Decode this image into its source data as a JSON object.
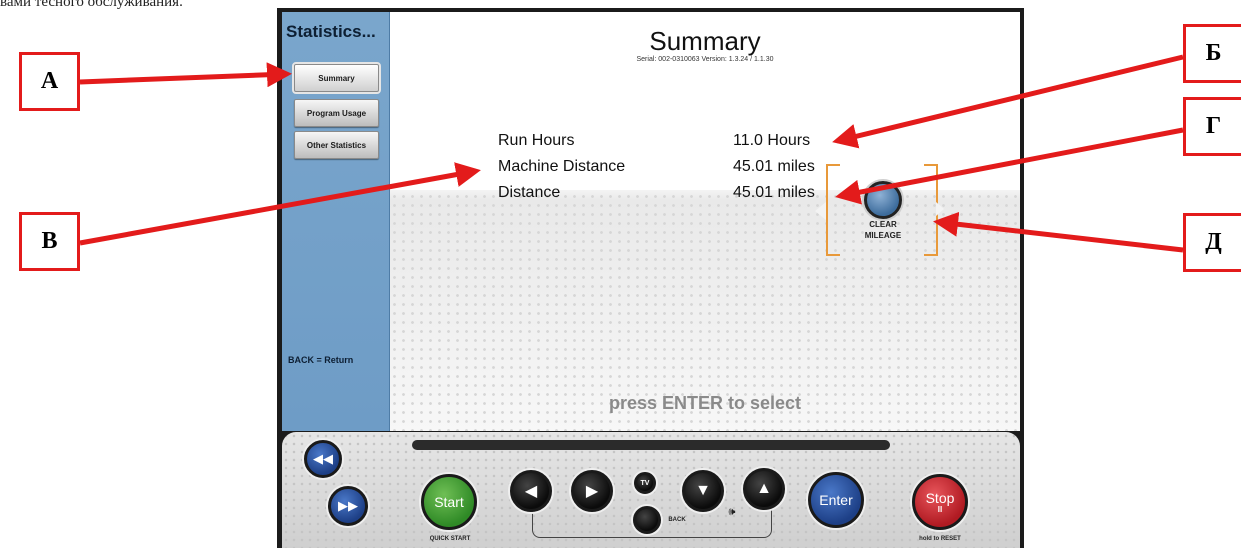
{
  "caption": "вами тесного обслуживания.",
  "sidebar": {
    "title": "Statistics...",
    "items": [
      {
        "label": "Summary"
      },
      {
        "label": "Program Usage"
      },
      {
        "label": "Other Statistics"
      }
    ],
    "back_hint": "BACK = Return"
  },
  "main": {
    "title": "Summary",
    "serial": "Serial: 002-0310063  Version: 1.3.24 / 1.1.30",
    "stats": [
      {
        "label": "Run Hours",
        "value": "11.0 Hours"
      },
      {
        "label": "Machine Distance",
        "value": "45.01 miles"
      },
      {
        "label": "Distance",
        "value": "45.01 miles"
      }
    ],
    "clear_button": {
      "line1": "CLEAR",
      "line2": "MILEAGE"
    },
    "press_enter": "press ENTER to select"
  },
  "console": {
    "start": "Start",
    "start_sub": "QUICK START",
    "back": "BACK",
    "enter": "Enter",
    "stop": "Stop",
    "stop_symbol": "II",
    "stop_sub": "hold to RESET",
    "tv_icon": "TV",
    "volume_icon": "🕪",
    "rewind_icon": "◀◀",
    "forward_icon": "▶▶",
    "left_icon": "◀",
    "right_icon": "▶",
    "down_icon": "▼",
    "up_icon": "▲"
  },
  "callouts": {
    "a": "А",
    "b": "Б",
    "g": "Г",
    "v": "В",
    "d": "Д"
  },
  "colors": {
    "sidebar": "#6e9cc6",
    "callout_red": "#e31b1b",
    "bracket_orange": "#e8993a"
  }
}
